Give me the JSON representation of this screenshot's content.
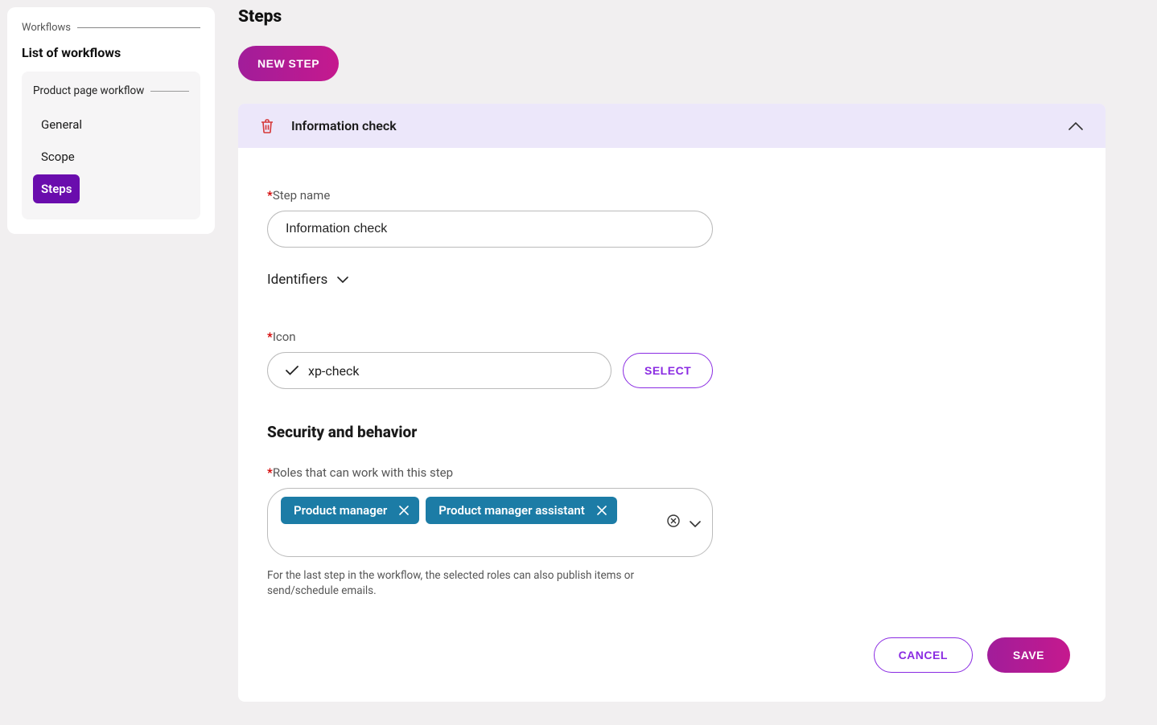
{
  "sidebar": {
    "title": "Workflows",
    "heading": "List of workflows",
    "workflow": {
      "title": "Product page workflow",
      "items": [
        {
          "label": "General",
          "active": false
        },
        {
          "label": "Scope",
          "active": false
        },
        {
          "label": "Steps",
          "active": true
        }
      ]
    }
  },
  "page": {
    "title": "Steps",
    "new_step": "NEW STEP"
  },
  "step": {
    "header_title": "Information check",
    "name_label": "Step name",
    "name_value": "Information check",
    "identifiers_label": "Identifiers",
    "icon_label": "Icon",
    "icon_value": "xp-check",
    "select_label": "SELECT",
    "security_heading": "Security and behavior",
    "roles_label": "Roles that can work with this step",
    "roles": [
      {
        "label": "Product manager"
      },
      {
        "label": "Product manager assistant"
      }
    ],
    "roles_help": "For the last step in the workflow, the selected roles can also publish items or send/schedule emails."
  },
  "footer": {
    "cancel": "CANCEL",
    "save": "SAVE"
  }
}
